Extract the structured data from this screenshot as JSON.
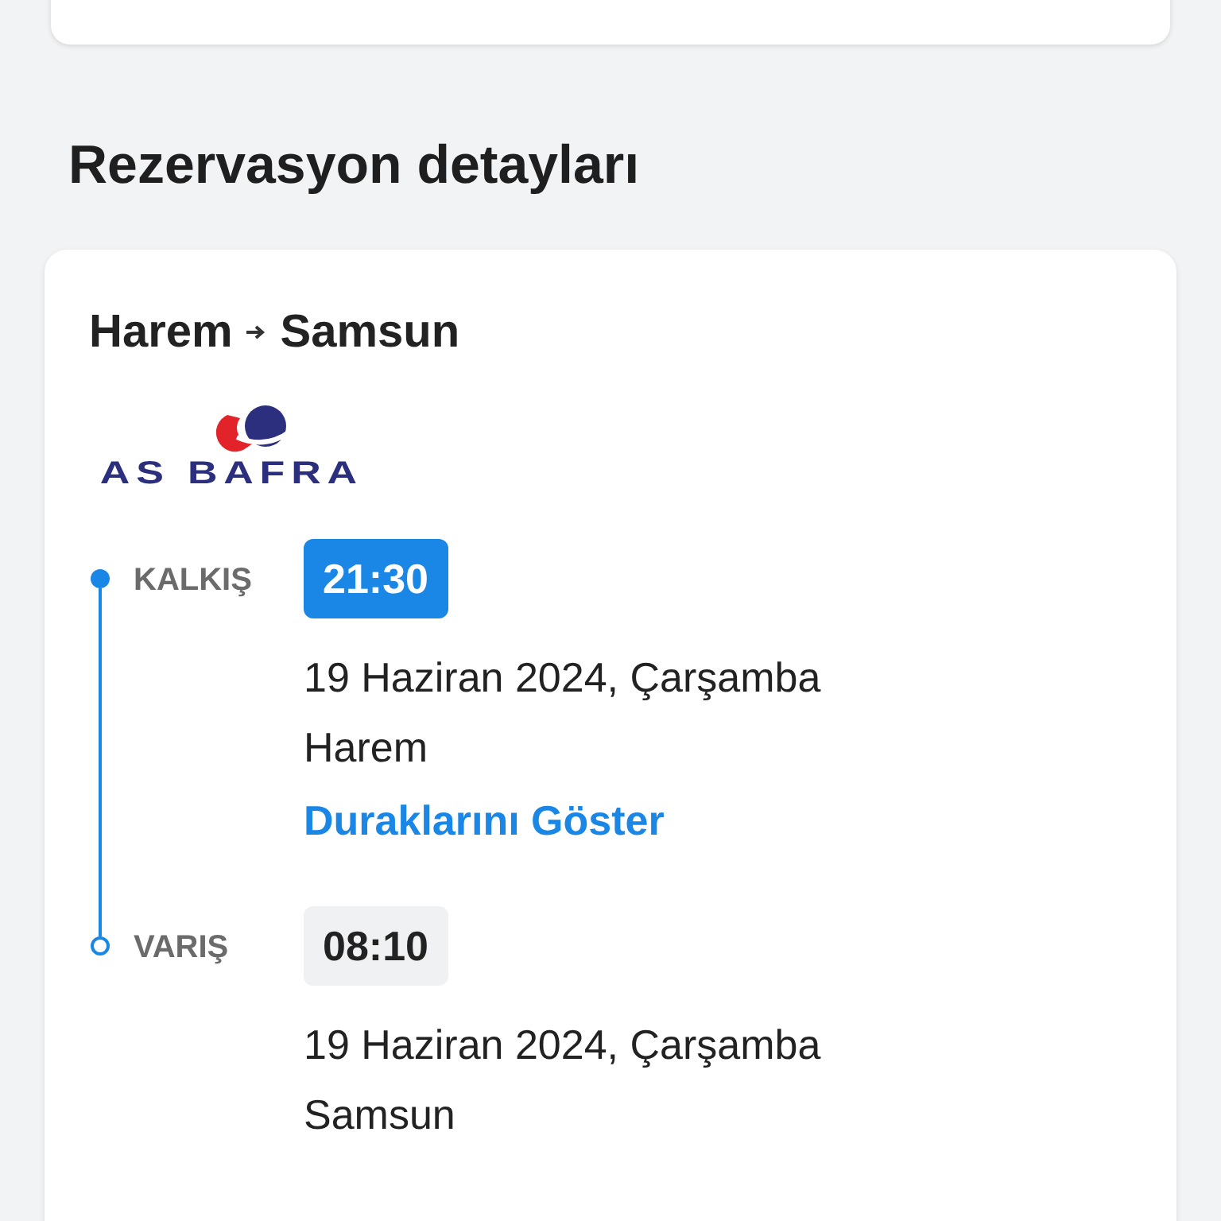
{
  "section_title": "Rezervasyon detayları",
  "trip": {
    "origin": "Harem",
    "destination": "Samsun",
    "operator_logo_text": "AS BAFRA",
    "stops": [
      {
        "kind": "departure",
        "label": "KALKIŞ",
        "time": "21:30",
        "date": "19 Haziran 2024, Çarşamba",
        "place": "Harem",
        "link": "Duraklarını Göster"
      },
      {
        "kind": "arrival",
        "label": "VARIŞ",
        "time": "08:10",
        "date": "19 Haziran 2024, Çarşamba",
        "place": "Samsun"
      }
    ]
  }
}
